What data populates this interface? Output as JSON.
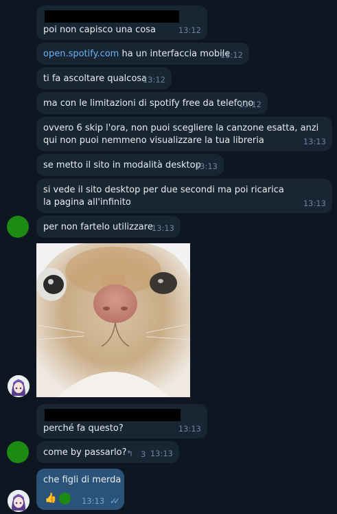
{
  "messages": [
    {
      "text": "poi non capisco una cosa",
      "time": "13:12"
    },
    {
      "link": "open.spotify.com",
      "text": " ha un interfaccia mobile",
      "time": "13:12"
    },
    {
      "text": "ti fa ascoltare qualcosa",
      "time": "13:12"
    },
    {
      "text": "ma con le limitazioni di spotify free da telefono",
      "time": "13:12"
    },
    {
      "text": "ovvero 6 skip l'ora, non puoi scegliere la canzone esatta, anzi qui non puoi nemmeno visualizzare la tua libreria",
      "time": "13:13"
    },
    {
      "text": "se metto il sito in modalità desktop",
      "time": "13:13"
    },
    {
      "text": "si vede il sito desktop per due secondi ma poi ricarica la pagina all'infinito",
      "time": "13:13"
    },
    {
      "text": "per non fartelo utilizzare",
      "time": "13:13"
    },
    {
      "text": "perché fa questo?",
      "time": "13:13"
    },
    {
      "text": "come by passarlo?",
      "time": "13:13",
      "reply_count": "3"
    },
    {
      "text": "che figli di merda",
      "time": "13:13",
      "reaction": "👍"
    }
  ],
  "icons": {
    "reply": "reply-arrow-icon",
    "read": "double-check-icon"
  },
  "colors": {
    "background": "#0e1621",
    "incoming_bubble": "#182533",
    "outgoing_bubble": "#2b5278",
    "link": "#6ab3f3",
    "timestamp": "#6d8499"
  }
}
